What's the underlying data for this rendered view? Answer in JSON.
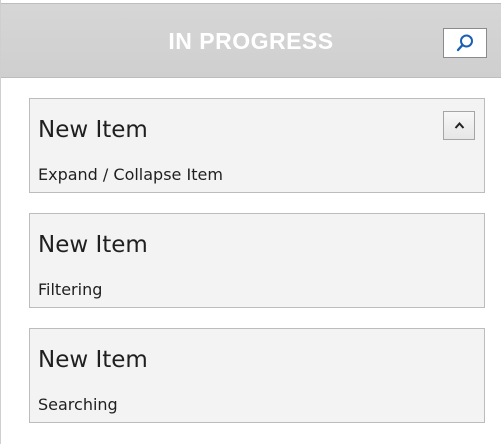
{
  "header": {
    "title": "IN PROGRESS",
    "search_icon": "search-icon"
  },
  "items": [
    {
      "title": "New Item",
      "subtitle": "Expand / Collapse Item",
      "expanded": true
    },
    {
      "title": "New Item",
      "subtitle": "Filtering"
    },
    {
      "title": "New Item",
      "subtitle": "Searching"
    }
  ],
  "colors": {
    "header_background": "#d2d2d2",
    "header_text": "#ffffff",
    "card_background": "#f3f3f3",
    "card_border": "#bcbcbc",
    "search_icon": "#1a5fb4"
  }
}
